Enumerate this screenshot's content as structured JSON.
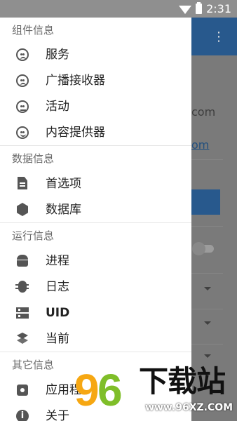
{
  "status_bar": {
    "time": "2:31"
  },
  "app_bar": {
    "menu_icon": "⋮"
  },
  "background": {
    "text_fragment": "com",
    "link_fragment": "om"
  },
  "drawer": {
    "sections": [
      {
        "title": "组件信息",
        "items": [
          {
            "label": "服务",
            "icon": "sad-face-icon"
          },
          {
            "label": "广播接收器",
            "icon": "sad-face-icon"
          },
          {
            "label": "活动",
            "icon": "neutral-face-icon"
          },
          {
            "label": "内容提供器",
            "icon": "happy-face-icon"
          }
        ]
      },
      {
        "title": "数据信息",
        "items": [
          {
            "label": "首选项",
            "icon": "document-icon"
          },
          {
            "label": "数据库",
            "icon": "database-icon"
          }
        ]
      },
      {
        "title": "运行信息",
        "items": [
          {
            "label": "进程",
            "icon": "android-icon"
          },
          {
            "label": "日志",
            "icon": "bug-icon"
          },
          {
            "label": "UID",
            "icon": "server-icon"
          },
          {
            "label": "当前",
            "icon": "layers-icon"
          }
        ]
      },
      {
        "title": "其它信息",
        "items": [
          {
            "label": "应用程",
            "icon": "settings-icon"
          },
          {
            "label": "关于",
            "icon": "info-icon"
          }
        ]
      }
    ]
  },
  "watermark": {
    "number_9": "9",
    "number_6": "6",
    "title": "下载站",
    "url": "www.96XZ.COM"
  }
}
